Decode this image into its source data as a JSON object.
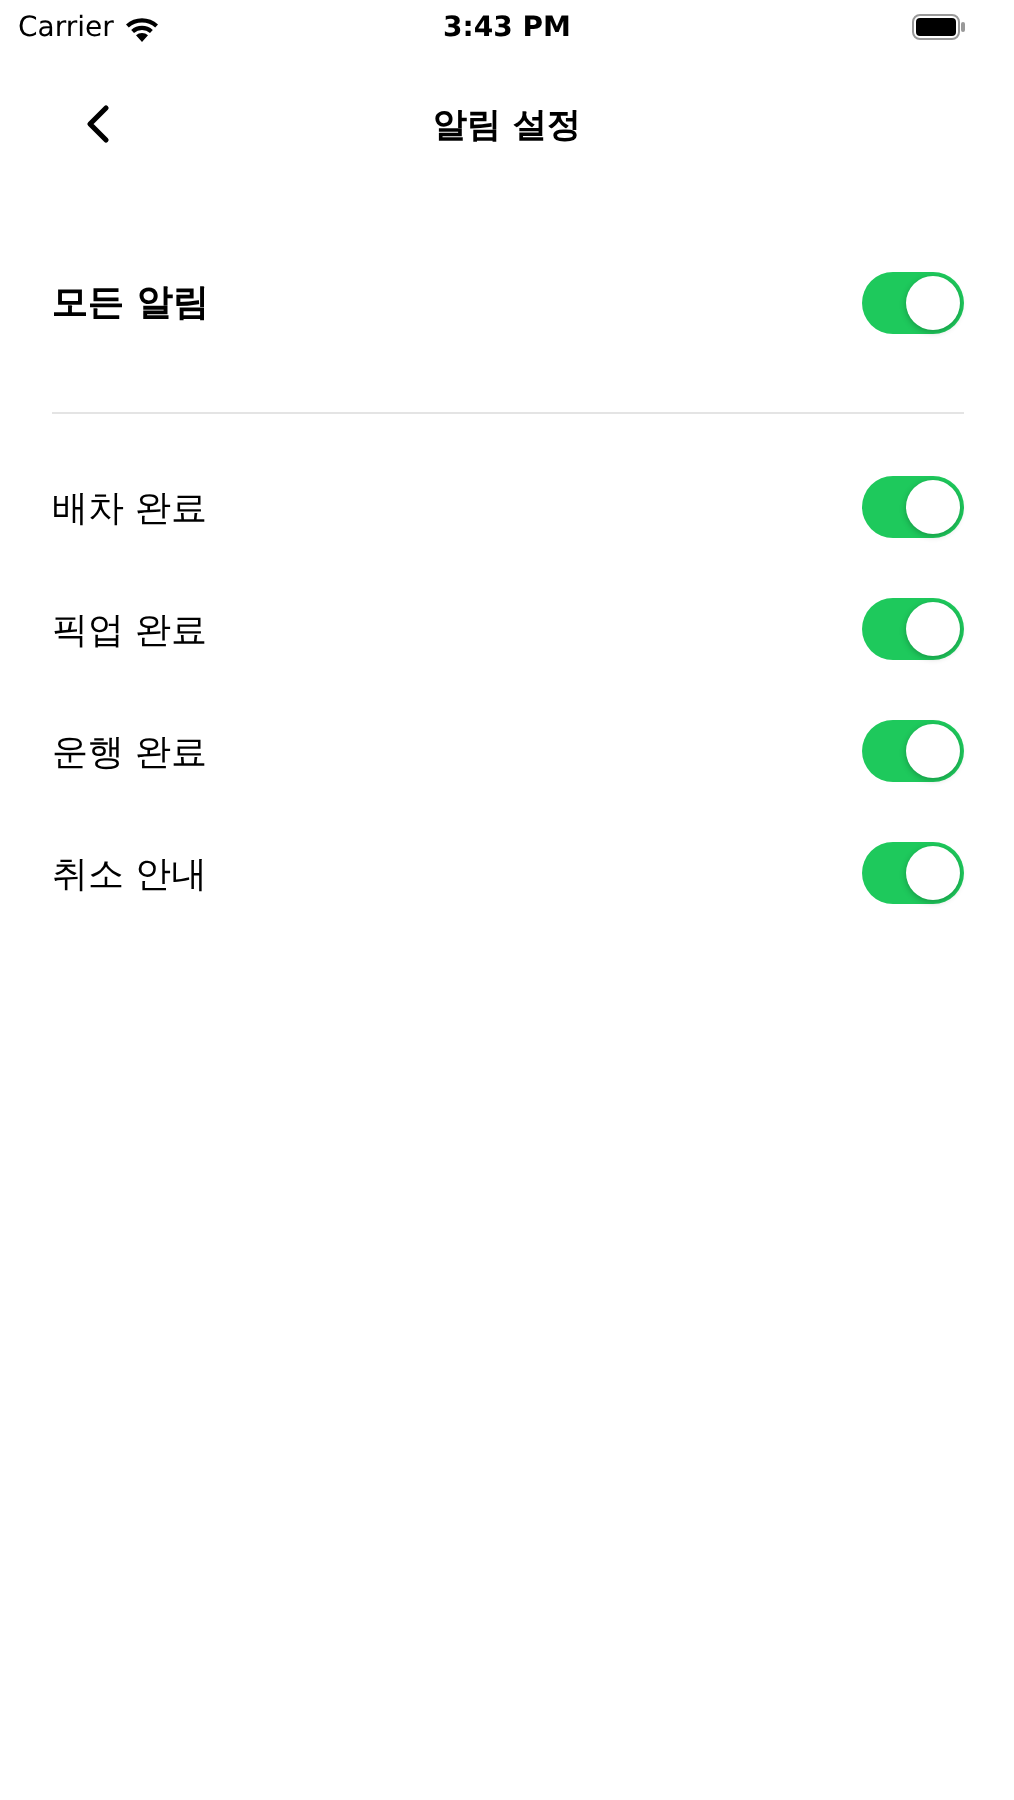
{
  "status_bar": {
    "carrier": "Carrier",
    "time": "3:43 PM"
  },
  "nav": {
    "title": "알림 설정"
  },
  "master": {
    "label": "모든 알림",
    "on": true
  },
  "items": [
    {
      "label": "배차 완료",
      "on": true
    },
    {
      "label": "픽업 완료",
      "on": true
    },
    {
      "label": "운행 완료",
      "on": true
    },
    {
      "label": "취소 안내",
      "on": true
    }
  ]
}
